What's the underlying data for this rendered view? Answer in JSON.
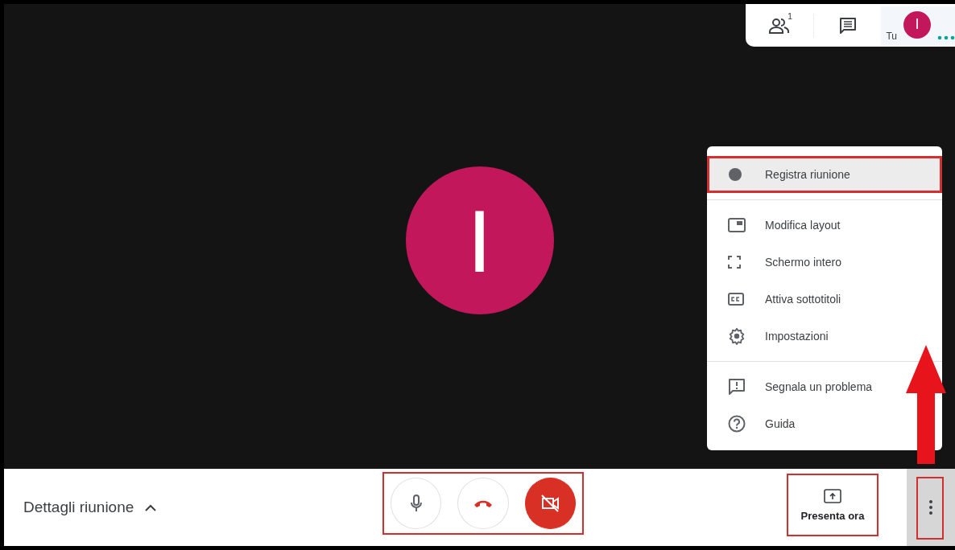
{
  "top_panel": {
    "participants_count": "1",
    "you_label": "Tu",
    "avatar_letter": "I"
  },
  "stage": {
    "avatar_letter": "I"
  },
  "menu": {
    "sections": [
      {
        "items": [
          {
            "kind": "record",
            "label": "Registra riunione",
            "highlighted": true
          }
        ]
      },
      {
        "items": [
          {
            "kind": "layout",
            "label": "Modifica layout",
            "highlighted": false
          },
          {
            "kind": "fullscreen",
            "label": "Schermo intero",
            "highlighted": false
          },
          {
            "kind": "captions",
            "label": "Attiva sottotitoli",
            "highlighted": false
          },
          {
            "kind": "settings",
            "label": "Impostazioni",
            "highlighted": false
          }
        ]
      },
      {
        "items": [
          {
            "kind": "report",
            "label": "Segnala un problema",
            "highlighted": false
          },
          {
            "kind": "help",
            "label": "Guida",
            "highlighted": false
          }
        ]
      }
    ]
  },
  "bottom_bar": {
    "meeting_details": "Dettagli riunione",
    "mic_on": true,
    "camera_on": false,
    "present_label": "Presenta ora"
  }
}
